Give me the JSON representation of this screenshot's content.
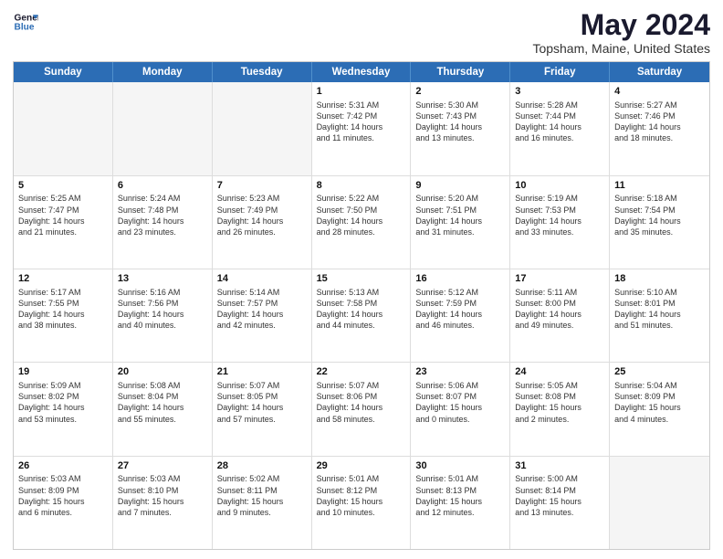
{
  "header": {
    "logo_line1": "General",
    "logo_line2": "Blue",
    "main_title": "May 2024",
    "subtitle": "Topsham, Maine, United States"
  },
  "days_of_week": [
    "Sunday",
    "Monday",
    "Tuesday",
    "Wednesday",
    "Thursday",
    "Friday",
    "Saturday"
  ],
  "weeks": [
    [
      {
        "day": "",
        "info": ""
      },
      {
        "day": "",
        "info": ""
      },
      {
        "day": "",
        "info": ""
      },
      {
        "day": "1",
        "info": "Sunrise: 5:31 AM\nSunset: 7:42 PM\nDaylight: 14 hours\nand 11 minutes."
      },
      {
        "day": "2",
        "info": "Sunrise: 5:30 AM\nSunset: 7:43 PM\nDaylight: 14 hours\nand 13 minutes."
      },
      {
        "day": "3",
        "info": "Sunrise: 5:28 AM\nSunset: 7:44 PM\nDaylight: 14 hours\nand 16 minutes."
      },
      {
        "day": "4",
        "info": "Sunrise: 5:27 AM\nSunset: 7:46 PM\nDaylight: 14 hours\nand 18 minutes."
      }
    ],
    [
      {
        "day": "5",
        "info": "Sunrise: 5:25 AM\nSunset: 7:47 PM\nDaylight: 14 hours\nand 21 minutes."
      },
      {
        "day": "6",
        "info": "Sunrise: 5:24 AM\nSunset: 7:48 PM\nDaylight: 14 hours\nand 23 minutes."
      },
      {
        "day": "7",
        "info": "Sunrise: 5:23 AM\nSunset: 7:49 PM\nDaylight: 14 hours\nand 26 minutes."
      },
      {
        "day": "8",
        "info": "Sunrise: 5:22 AM\nSunset: 7:50 PM\nDaylight: 14 hours\nand 28 minutes."
      },
      {
        "day": "9",
        "info": "Sunrise: 5:20 AM\nSunset: 7:51 PM\nDaylight: 14 hours\nand 31 minutes."
      },
      {
        "day": "10",
        "info": "Sunrise: 5:19 AM\nSunset: 7:53 PM\nDaylight: 14 hours\nand 33 minutes."
      },
      {
        "day": "11",
        "info": "Sunrise: 5:18 AM\nSunset: 7:54 PM\nDaylight: 14 hours\nand 35 minutes."
      }
    ],
    [
      {
        "day": "12",
        "info": "Sunrise: 5:17 AM\nSunset: 7:55 PM\nDaylight: 14 hours\nand 38 minutes."
      },
      {
        "day": "13",
        "info": "Sunrise: 5:16 AM\nSunset: 7:56 PM\nDaylight: 14 hours\nand 40 minutes."
      },
      {
        "day": "14",
        "info": "Sunrise: 5:14 AM\nSunset: 7:57 PM\nDaylight: 14 hours\nand 42 minutes."
      },
      {
        "day": "15",
        "info": "Sunrise: 5:13 AM\nSunset: 7:58 PM\nDaylight: 14 hours\nand 44 minutes."
      },
      {
        "day": "16",
        "info": "Sunrise: 5:12 AM\nSunset: 7:59 PM\nDaylight: 14 hours\nand 46 minutes."
      },
      {
        "day": "17",
        "info": "Sunrise: 5:11 AM\nSunset: 8:00 PM\nDaylight: 14 hours\nand 49 minutes."
      },
      {
        "day": "18",
        "info": "Sunrise: 5:10 AM\nSunset: 8:01 PM\nDaylight: 14 hours\nand 51 minutes."
      }
    ],
    [
      {
        "day": "19",
        "info": "Sunrise: 5:09 AM\nSunset: 8:02 PM\nDaylight: 14 hours\nand 53 minutes."
      },
      {
        "day": "20",
        "info": "Sunrise: 5:08 AM\nSunset: 8:04 PM\nDaylight: 14 hours\nand 55 minutes."
      },
      {
        "day": "21",
        "info": "Sunrise: 5:07 AM\nSunset: 8:05 PM\nDaylight: 14 hours\nand 57 minutes."
      },
      {
        "day": "22",
        "info": "Sunrise: 5:07 AM\nSunset: 8:06 PM\nDaylight: 14 hours\nand 58 minutes."
      },
      {
        "day": "23",
        "info": "Sunrise: 5:06 AM\nSunset: 8:07 PM\nDaylight: 15 hours\nand 0 minutes."
      },
      {
        "day": "24",
        "info": "Sunrise: 5:05 AM\nSunset: 8:08 PM\nDaylight: 15 hours\nand 2 minutes."
      },
      {
        "day": "25",
        "info": "Sunrise: 5:04 AM\nSunset: 8:09 PM\nDaylight: 15 hours\nand 4 minutes."
      }
    ],
    [
      {
        "day": "26",
        "info": "Sunrise: 5:03 AM\nSunset: 8:09 PM\nDaylight: 15 hours\nand 6 minutes."
      },
      {
        "day": "27",
        "info": "Sunrise: 5:03 AM\nSunset: 8:10 PM\nDaylight: 15 hours\nand 7 minutes."
      },
      {
        "day": "28",
        "info": "Sunrise: 5:02 AM\nSunset: 8:11 PM\nDaylight: 15 hours\nand 9 minutes."
      },
      {
        "day": "29",
        "info": "Sunrise: 5:01 AM\nSunset: 8:12 PM\nDaylight: 15 hours\nand 10 minutes."
      },
      {
        "day": "30",
        "info": "Sunrise: 5:01 AM\nSunset: 8:13 PM\nDaylight: 15 hours\nand 12 minutes."
      },
      {
        "day": "31",
        "info": "Sunrise: 5:00 AM\nSunset: 8:14 PM\nDaylight: 15 hours\nand 13 minutes."
      },
      {
        "day": "",
        "info": ""
      }
    ]
  ]
}
